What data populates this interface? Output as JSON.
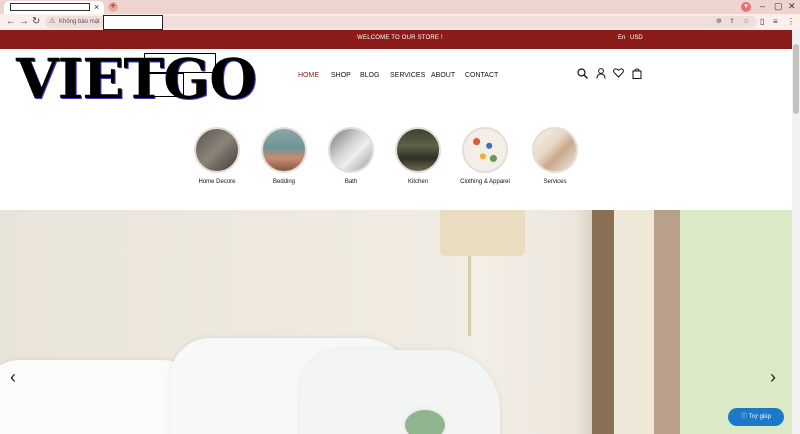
{
  "browser": {
    "tab_close": "×",
    "new_tab": "+",
    "security_label": "Không bảo mật",
    "nav": {
      "back": "←",
      "forward": "→",
      "reload": "↻"
    }
  },
  "store": {
    "announcement": "WELCOME TO OUR STORE !",
    "language": "En",
    "currency": "USD",
    "logo": "VIETGO",
    "menu": [
      "HOME",
      "SHOP",
      "BLOG",
      "SERVICES",
      "ABOUT",
      "CONTACT"
    ],
    "categories": [
      {
        "label": "Home Decore"
      },
      {
        "label": "Bedding"
      },
      {
        "label": "Bath"
      },
      {
        "label": "Kitchen"
      },
      {
        "label": "Clothing & Apparel"
      },
      {
        "label": "Services"
      }
    ],
    "help_button": "Trợ giúp"
  },
  "colors": {
    "accent": "#8b1c1a",
    "help": "#1b79c8"
  }
}
